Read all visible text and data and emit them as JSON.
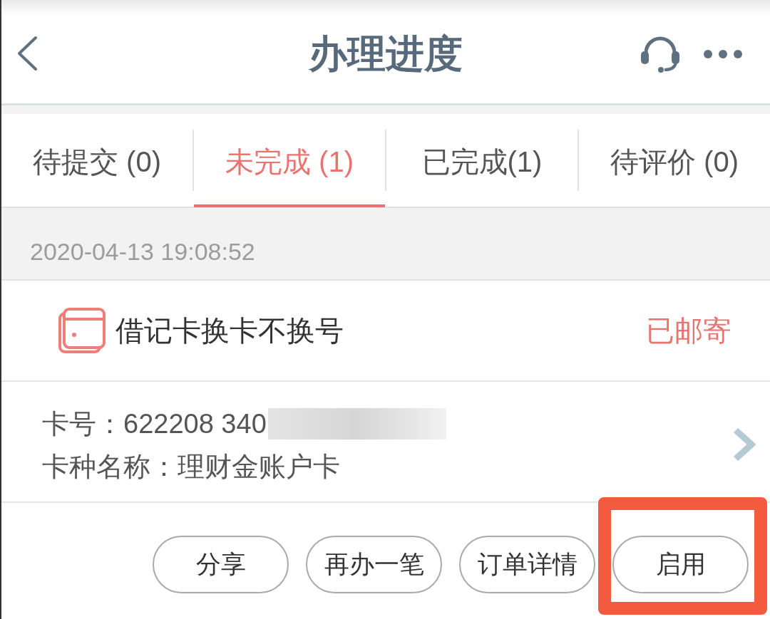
{
  "header": {
    "title": "办理进度"
  },
  "tabs": [
    {
      "label": "待提交 (0)",
      "selected": false
    },
    {
      "label": "未完成 (1)",
      "selected": true
    },
    {
      "label": "已完成(1)",
      "selected": false
    },
    {
      "label": "待评价 (0)",
      "selected": false
    }
  ],
  "order": {
    "time": "2020-04-13 19:08:52",
    "title": "借记卡换卡不换号",
    "status": "已邮寄",
    "details": [
      {
        "text": "卡号：622208 340",
        "masked": true
      },
      {
        "text": "卡种名称：理财金账户卡",
        "masked": false
      }
    ]
  },
  "actions": [
    {
      "label": "分享",
      "highlighted": false
    },
    {
      "label": "再办一笔",
      "highlighted": false
    },
    {
      "label": "订单详情",
      "highlighted": false
    },
    {
      "label": "启用",
      "highlighted": true
    }
  ]
}
